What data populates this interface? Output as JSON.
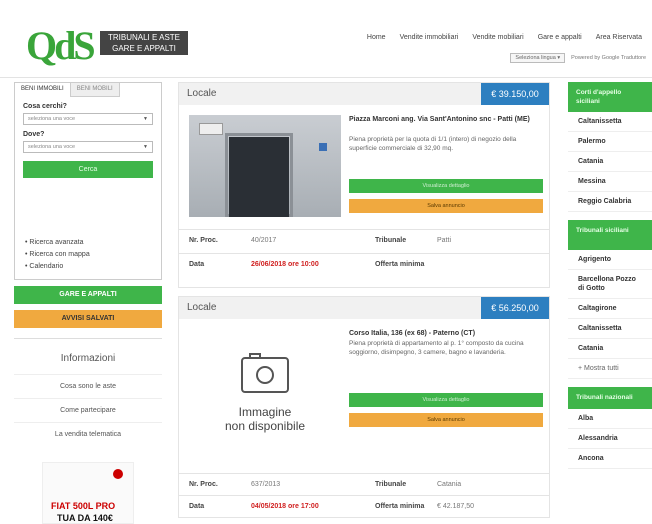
{
  "header": {
    "logo_main": "QdS",
    "logo_line1": "TRIBUNALI E ASTE",
    "logo_line2": "GARE E APPALTI",
    "nav": [
      "Home",
      "Vendite immobiliari",
      "Vendite mobiliari",
      "Gare e appalti",
      "Area Riservata"
    ],
    "language_select": "Seleziona lingua",
    "powered_by": "Powered by Google Traduttore"
  },
  "search": {
    "tabs": [
      "BENI IMMOBILI",
      "BENI MOBILI"
    ],
    "what_label": "Cosa cerchi?",
    "what_value": "seleziona una voce",
    "where_label": "Dove?",
    "where_value": "seleziona una voce",
    "submit_label": "Cerca",
    "links": [
      "Ricerca avanzata",
      "Ricerca con mappa",
      "Calendario"
    ]
  },
  "left_buttons": {
    "gare": "GARE E APPALTI",
    "avvisi": "AVVISI SALVATI"
  },
  "info": {
    "title": "Informazioni",
    "items": [
      "Cosa sono le aste",
      "Come partecipare",
      "La vendita telematica"
    ]
  },
  "ad": {
    "title": "FIAT 500L PRO",
    "subtitle": "TUA DA 140€"
  },
  "listings": [
    {
      "title": "Locale",
      "price": "€ 39.150,00",
      "address": "Piazza Marconi ang. Via Sant'Antonino snc - Patti (ME)",
      "description": "Piena proprietà per la quota di 1/1 (intero) di negozio della superficie commerciale di 32,90 mq.",
      "btn_green": "Visualizza dettaglio",
      "btn_orange": "Salva annuncio",
      "proc_label": "Nr. Proc.",
      "proc_value": "40/2017",
      "court_label": "Tribunale",
      "court_value": "Patti",
      "date_label": "Data",
      "date_value": "26/06/2018 ore 10:00",
      "offer_label": "Offerta minima",
      "offer_value": ""
    },
    {
      "title": "Locale",
      "price": "€ 56.250,00",
      "no_image_line1": "Immagine",
      "no_image_line2": "non disponibile",
      "address": "Corso Italia, 136 (ex 68) - Paterno (CT)",
      "description": "Piena proprietà di appartamento al p. 1° composto da cucina soggiorno, disimpegno, 3 camere, bagno e lavanderia.",
      "btn_green": "Visualizza dettaglio",
      "btn_orange": "Salva annuncio",
      "proc_label": "Nr. Proc.",
      "proc_value": "637/2013",
      "court_label": "Tribunale",
      "court_value": "Catania",
      "date_label": "Data",
      "date_value": "04/05/2018 ore 17:00",
      "offer_label": "Offerta minima",
      "offer_value": "€ 42.187,50"
    }
  ],
  "right": {
    "box1_title": "Corti d'appello siciliani",
    "box1_items": [
      "Caltanissetta",
      "Palermo",
      "Catania",
      "Messina",
      "Reggio Calabria"
    ],
    "box2_title": "Tribunali siciliani",
    "box2_items": [
      "Agrigento",
      "Barcellona Pozzo di Gotto",
      "Caltagirone",
      "Caltanissetta",
      "Catania"
    ],
    "box2_more": "+ Mostra tutti",
    "box3_title": "Tribunali nazionali",
    "box3_items": [
      "Alba",
      "Alessandria",
      "Ancona"
    ]
  }
}
